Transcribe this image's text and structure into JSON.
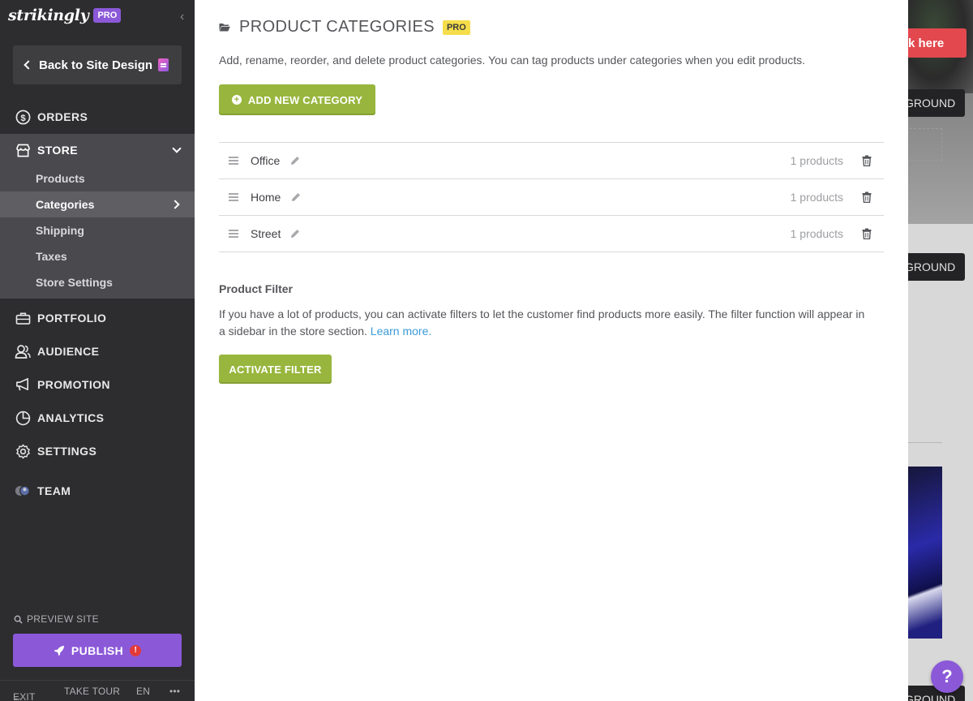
{
  "sidebar": {
    "brand": "strikingly",
    "brand_badge": "PRO",
    "back_label": "Back to Site Design",
    "nav": {
      "orders": "ORDERS",
      "store": "STORE",
      "portfolio": "PORTFOLIO",
      "audience": "AUDIENCE",
      "promotion": "PROMOTION",
      "analytics": "ANALYTICS",
      "settings": "SETTINGS",
      "team": "TEAM"
    },
    "store_items": [
      "Products",
      "Categories",
      "Shipping",
      "Taxes",
      "Store Settings"
    ],
    "active_store_item": "Categories",
    "preview_label": "PREVIEW SITE",
    "publish_label": "PUBLISH",
    "publish_alert": "!",
    "footer": {
      "exit": "EXIT",
      "tour": "TAKE TOUR",
      "lang": "EN",
      "more": "•••"
    }
  },
  "main": {
    "title": "PRODUCT CATEGORIES",
    "title_badge": "PRO",
    "intro": "Add, rename, reorder, and delete product categories. You can tag products under categories when you edit products.",
    "add_button": "ADD NEW CATEGORY",
    "categories": [
      {
        "name": "Office",
        "count": "1 products"
      },
      {
        "name": "Home",
        "count": "1 products"
      },
      {
        "name": "Street",
        "count": "1 products"
      }
    ],
    "filter_title": "Product Filter",
    "filter_text": "If you have a lot of products, you can activate filters to let the customer find products more easily. The filter function will appear in a sidebar in the store section.",
    "learn_more": "Learn more.",
    "activate_button": "ACTIVATE FILTER"
  },
  "background_site": {
    "cta_text": "k here",
    "bg_button": "GROUND"
  },
  "help_label": "?",
  "colors": {
    "sidebar_bg": "#2d2d2f",
    "accent_purple": "#8b59d8",
    "accent_green": "#98b63d",
    "pro_yellow": "#f5dd4b",
    "link_blue": "#3a9bd7"
  }
}
